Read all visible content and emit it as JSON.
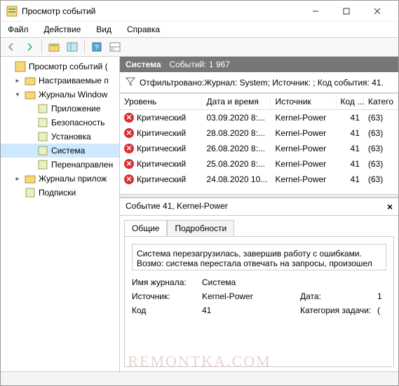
{
  "window": {
    "title": "Просмотр событий"
  },
  "menu": {
    "file": "Файл",
    "action": "Действие",
    "view": "Вид",
    "help": "Справка"
  },
  "tree": {
    "root": "Просмотр событий (",
    "custom": "Настраиваемые п",
    "winlogs": "Журналы Window",
    "app": "Приложение",
    "security": "Безопасность",
    "setup": "Установка",
    "system": "Система",
    "forwarded": "Перенаправлен",
    "applogs": "Журналы прилож",
    "subs": "Подписки"
  },
  "header": {
    "title": "Система",
    "count_label": "Событий: 1 967"
  },
  "filter": {
    "text": "Отфильтровано:Журнал: System; Источник: ; Код события: 41."
  },
  "columns": {
    "level": "Уровень",
    "datetime": "Дата и время",
    "source": "Источник",
    "id": "Код ...",
    "cat": "Катего"
  },
  "rows": [
    {
      "level": "Критический",
      "dt": "03.09.2020 8:...",
      "src": "Kernel-Power",
      "id": "41",
      "cat": "(63)"
    },
    {
      "level": "Критический",
      "dt": "28.08.2020 8:...",
      "src": "Kernel-Power",
      "id": "41",
      "cat": "(63)"
    },
    {
      "level": "Критический",
      "dt": "26.08.2020 8:...",
      "src": "Kernel-Power",
      "id": "41",
      "cat": "(63)"
    },
    {
      "level": "Критический",
      "dt": "25.08.2020 8:...",
      "src": "Kernel-Power",
      "id": "41",
      "cat": "(63)"
    },
    {
      "level": "Критический",
      "dt": "24.08.2020 10...",
      "src": "Kernel-Power",
      "id": "41",
      "cat": "(63)"
    }
  ],
  "detail": {
    "title": "Событие 41, Kernel-Power",
    "tab_general": "Общие",
    "tab_details": "Подробности",
    "description": "Система перезагрузилась, завершив работу с ошибками. Возмо: система перестала отвечать на запросы, произошел критически",
    "p_logname_l": "Имя журнала:",
    "p_logname_v": "Система",
    "p_source_l": "Источник:",
    "p_source_v": "Kernel-Power",
    "p_date_l": "Дата:",
    "p_date_v": "1",
    "p_code_l": "Код",
    "p_code_v": "41",
    "p_cat_l": "Категория задачи:",
    "p_cat_v": "("
  },
  "watermark": "REMONTKA.COM"
}
